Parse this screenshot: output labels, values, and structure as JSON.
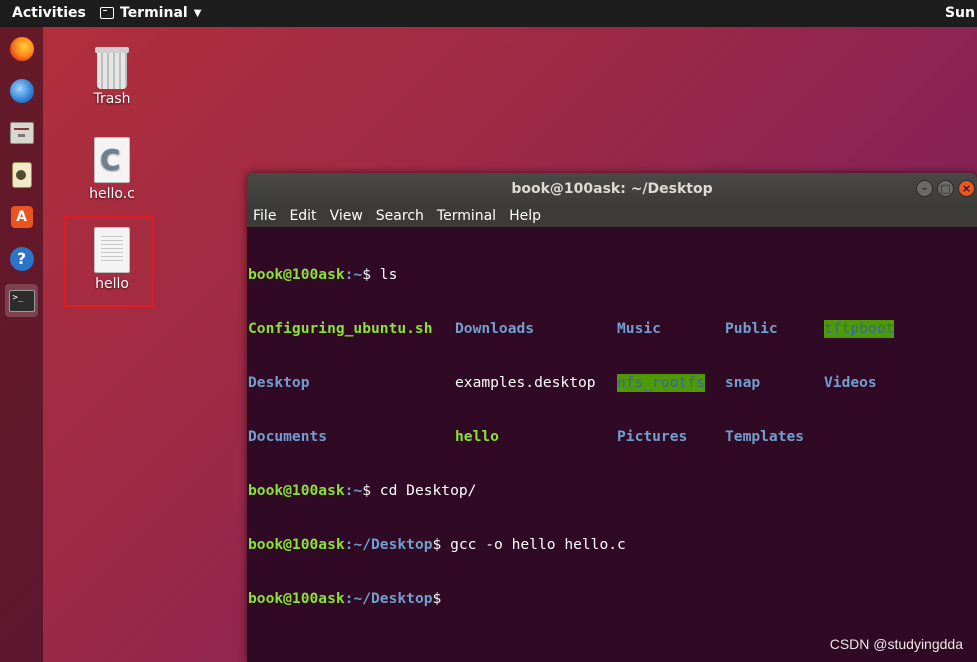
{
  "topbar": {
    "activities": "Activities",
    "app_name": "Terminal",
    "clock": "Sun"
  },
  "dock": {
    "items": [
      {
        "name": "firefox"
      },
      {
        "name": "thunderbird"
      },
      {
        "name": "files"
      },
      {
        "name": "rhythmbox"
      },
      {
        "name": "ubuntu-software"
      },
      {
        "name": "help"
      },
      {
        "name": "terminal",
        "active": true
      }
    ]
  },
  "desktop": {
    "icons": [
      {
        "label": "Trash"
      },
      {
        "label": "hello.c"
      },
      {
        "label": "hello"
      }
    ]
  },
  "window": {
    "title": "book@100ask: ~/Desktop",
    "menu": [
      "File",
      "Edit",
      "View",
      "Search",
      "Terminal",
      "Help"
    ]
  },
  "terminal": {
    "prompt_user": "book@100ask",
    "line1": {
      "path": ":~",
      "cmd": "$ ls"
    },
    "ls": {
      "row1": [
        "Configuring_ubuntu.sh",
        "Downloads",
        "Music",
        "Public",
        "tftpboot"
      ],
      "row2": [
        "Desktop",
        "examples.desktop",
        "nfs_rootfs",
        "snap",
        "Videos"
      ],
      "row3": [
        "Documents",
        "hello",
        "Pictures",
        "Templates"
      ]
    },
    "line2": {
      "path": ":~",
      "cmd": "$ cd Desktop/"
    },
    "line3": {
      "path": ":~/Desktop",
      "cmd": "$ gcc -o hello hello.c"
    },
    "line4": {
      "path": ":~/Desktop",
      "cmd": "$"
    }
  },
  "watermark": "CSDN @studyingdda",
  "colors": {
    "accent": "#e95420",
    "terminal_bg": "#300a24",
    "user_green": "#8ae234",
    "path_blue": "#729fcf"
  }
}
